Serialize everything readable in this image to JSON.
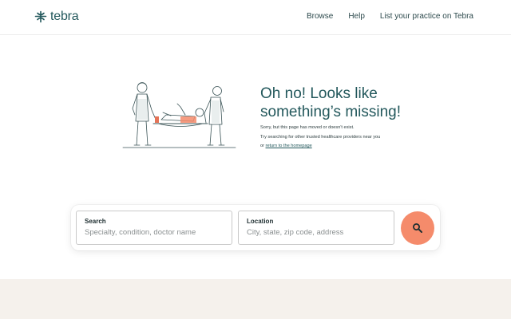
{
  "header": {
    "logo_text": "tebra",
    "nav": [
      "Browse",
      "Help",
      "List your practice on Tebra"
    ]
  },
  "error": {
    "heading_line1": "Oh no! Looks like",
    "heading_line2": "something’s missing!",
    "line1": "Sorry, but this page has moved or doesn't exist.",
    "line2": "Try searching for other trusted healthcare providers near you",
    "line3_prefix": "or ",
    "homepage_link": "return to the homepage"
  },
  "search": {
    "search_label": "Search",
    "search_placeholder": "Specialty, condition, doctor name",
    "location_label": "Location",
    "location_placeholder": "City, state, zip code, address"
  },
  "colors": {
    "brand": "#23585c",
    "search_button": "#f58b6b",
    "footer_band": "#f5f1ec"
  },
  "icons": [
    "tebra-logo-icon",
    "search-icon"
  ]
}
